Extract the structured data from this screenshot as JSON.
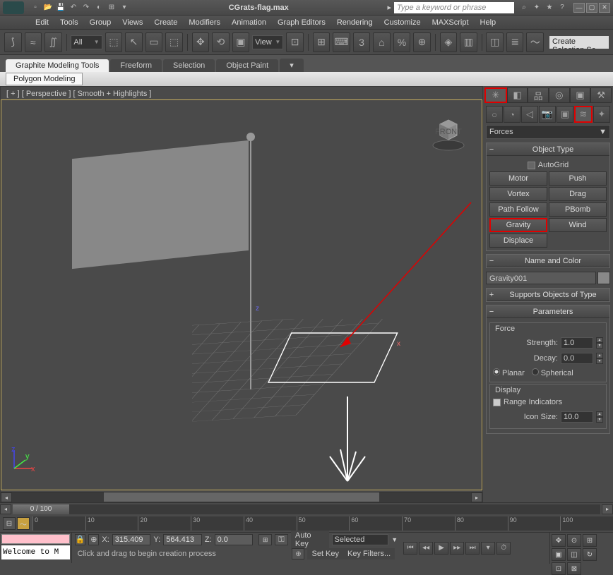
{
  "title": "CGrats-flag.max",
  "search_placeholder": "Type a keyword or phrase",
  "menu": [
    "Edit",
    "Tools",
    "Group",
    "Views",
    "Create",
    "Modifiers",
    "Animation",
    "Graph Editors",
    "Rendering",
    "Customize",
    "MAXScript",
    "Help"
  ],
  "toolbar": {
    "sel_mode": "All",
    "view": "View",
    "create_sel": "Create Selection Se"
  },
  "tabs": {
    "main": [
      "Graphite Modeling Tools",
      "Freeform",
      "Selection",
      "Object Paint"
    ],
    "active": 0,
    "sub": "Polygon Modeling"
  },
  "viewport": {
    "label": "[ + ] [ Perspective ] [ Smooth + Highlights ]",
    "axis_z": "z",
    "axis_x": "x",
    "gizmo_x": "x",
    "gizmo_y": "y",
    "gizmo_z": "z",
    "viewcube": "FRONT"
  },
  "cmd_panel": {
    "category": "Forces",
    "category_dd": "▼",
    "obj_type_title": "Object Type",
    "autogrid": "AutoGrid",
    "buttons": [
      [
        "Motor",
        "Push"
      ],
      [
        "Vortex",
        "Drag"
      ],
      [
        "Path Follow",
        "PBomb"
      ],
      [
        "Gravity",
        "Wind"
      ],
      [
        "Displace",
        ""
      ]
    ],
    "highlighted": "Gravity",
    "name_color_title": "Name and Color",
    "obj_name": "Gravity001",
    "supports_title": "Supports Objects of Type",
    "params_title": "Parameters",
    "force_group": "Force",
    "strength_lbl": "Strength:",
    "strength": "1.0",
    "decay_lbl": "Decay:",
    "decay": "0.0",
    "planar": "Planar",
    "spherical": "Spherical",
    "display_group": "Display",
    "range_ind": "Range Indicators",
    "icon_size_lbl": "Icon Size:",
    "icon_size": "10.0"
  },
  "time": {
    "frame": "0 / 100",
    "ruler": [
      "0",
      "10",
      "20",
      "30",
      "40",
      "50",
      "60",
      "70",
      "80",
      "90",
      "100"
    ]
  },
  "status": {
    "welcome": "Welcome to M",
    "x_lbl": "X:",
    "x": "315.409",
    "y_lbl": "Y:",
    "y": "564.413",
    "z_lbl": "Z:",
    "z": "0.0",
    "prompt": "Click and drag to begin creation process",
    "autokey": "Auto Key",
    "setkey": "Set Key",
    "selected": "Selected",
    "key_filters": "Key Filters..."
  }
}
